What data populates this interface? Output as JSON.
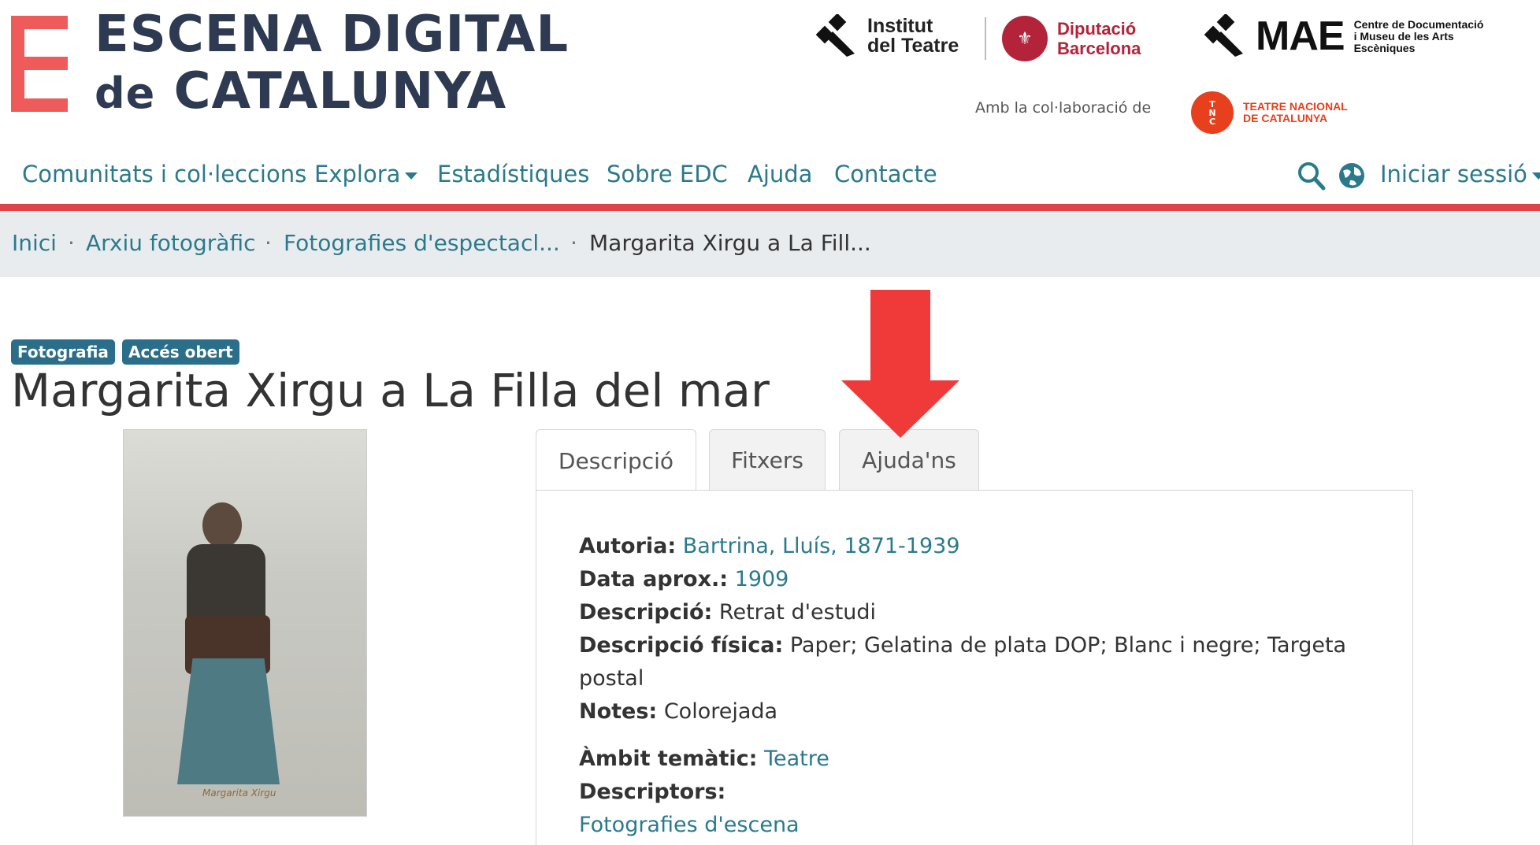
{
  "header": {
    "logo_line1": "ESCENA DIGITAL",
    "logo_line2_prefix": "de",
    "logo_line2_main": "CATALUNYA",
    "partners": {
      "institut_line1": "Institut",
      "institut_line2": "del Teatre",
      "diputacio_line1": "Diputació",
      "diputacio_line2": "Barcelona",
      "mae": "MAE",
      "mae_sub1": "Centre de Documentació",
      "mae_sub2": "i Museu de les Arts",
      "mae_sub3": "Escèniques",
      "collab_label": "Amb la col·laboració de",
      "tnc_line1": "TEATRE NACIONAL",
      "tnc_line2": "DE CATALUNYA"
    }
  },
  "nav": {
    "items": [
      "Comunitats i col·leccions",
      "Explora",
      "Estadístiques",
      "Sobre EDC",
      "Ajuda",
      "Contacte"
    ],
    "login": "Iniciar sessió"
  },
  "breadcrumb": {
    "items": [
      "Inici",
      "Arxiu fotogràfic",
      "Fotografies d'espectacl...",
      "Margarita Xirgu a La Fill..."
    ],
    "separator": "·"
  },
  "item": {
    "badges": [
      "Fotografia",
      "Accés obert"
    ],
    "title": "Margarita Xirgu a La Filla del mar",
    "photo_caption": "Margarita Xirgu"
  },
  "tabs": [
    "Descripció",
    "Fitxers",
    "Ajuda'ns"
  ],
  "description": {
    "autoria_label": "Autoria:",
    "autoria_value": "Bartrina, Lluís, 1871-1939",
    "data_label": "Data aprox.:",
    "data_value": "1909",
    "descripcio_label": "Descripció:",
    "descripcio_value": "Retrat d'estudi",
    "fisica_label": "Descripció física:",
    "fisica_value_line1": "Paper; Gelatina de plata DOP; Blanc i negre; Targeta",
    "fisica_value_line2": "postal",
    "notes_label": "Notes:",
    "notes_value": "Colorejada",
    "ambit_label": "Àmbit temàtic:",
    "ambit_value": "Teatre",
    "descriptors_label": "Descriptors:",
    "descriptors_value": "Fotografies d'escena"
  },
  "colors": {
    "brand_red": "#ef5b5b",
    "link_teal": "#2b7a8c",
    "badge_blue": "#2b6e8a",
    "annotation_arrow": "#f03a3a"
  }
}
